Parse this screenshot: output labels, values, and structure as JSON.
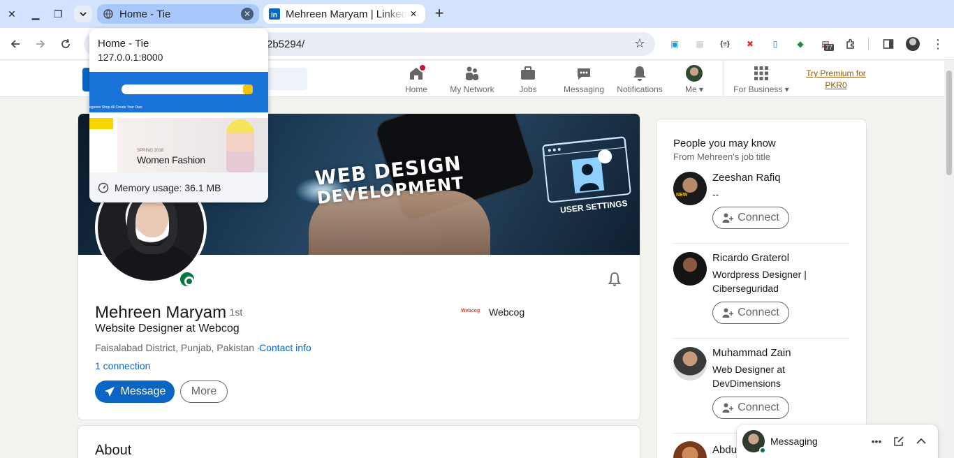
{
  "browser": {
    "tabs": [
      {
        "title": "Home - Tie",
        "active": false
      },
      {
        "title": "Mehreen Maryam | LinkedIn",
        "active": true
      }
    ],
    "url_visible": "2b5294/",
    "extension_badge": "77"
  },
  "hovercard": {
    "title": "Home - Tie",
    "url": "127.0.0.1:8000",
    "preview": {
      "nav": "egories    Shop All    Create Your Own",
      "season": "SPRING 2018",
      "hero": "Women Fashion"
    },
    "memory": "Memory usage: 36.1 MB"
  },
  "linkedin_nav": {
    "items": [
      {
        "label": "Home",
        "icon": "home-icon"
      },
      {
        "label": "My Network",
        "icon": "network-icon"
      },
      {
        "label": "Jobs",
        "icon": "briefcase-icon"
      },
      {
        "label": "Messaging",
        "icon": "messaging-icon"
      },
      {
        "label": "Notifications",
        "icon": "bell-icon"
      },
      {
        "label": "Me",
        "icon": "avatar-icon"
      },
      {
        "label": "For Business",
        "icon": "grid-icon"
      }
    ],
    "premium": "Try Premium for PKR0"
  },
  "banner": {
    "line1": "WEB DESIGN",
    "line2": "DEVELOPMENT",
    "settings": "USER SETTINGS"
  },
  "profile": {
    "name": "Mehreen Maryam",
    "degree": "· 1st",
    "headline": "Website Designer at Webcog",
    "location": "Faisalabad District, Punjab, Pakistan ·",
    "contact_info": "Contact info",
    "connections": "1 connection",
    "company_logo_text": "Webcog",
    "company": "Webcog",
    "message_btn": "Message",
    "more_btn": "More",
    "about_title": "About"
  },
  "sidebar": {
    "title": "People you may know",
    "subtitle": "From Mehreen's job title",
    "connect_label": "Connect",
    "people": [
      {
        "name": "Zeeshan Rafiq",
        "role": "--"
      },
      {
        "name": "Ricardo Graterol",
        "role": "Wordpress Designer | Ciberseguridad"
      },
      {
        "name": "Muhammad Zain",
        "role": "Web Designer at DevDimensions"
      },
      {
        "name": "Abdu",
        "role": ""
      }
    ]
  },
  "messaging": {
    "label": "Messaging"
  },
  "colors": {
    "linkedin_blue": "#0a66c2",
    "online_green": "#057642",
    "premium_gold": "#915907",
    "tabstrip": "#d3e3fd"
  }
}
